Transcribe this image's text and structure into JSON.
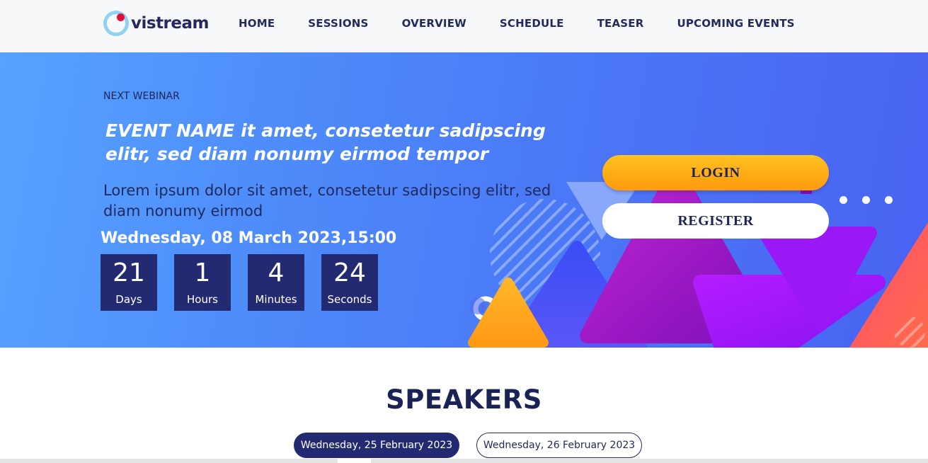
{
  "brand": {
    "name": "vistream",
    "ring_color": "#8fd3f2",
    "dot_color": "#e0103a"
  },
  "nav": {
    "items": [
      "HOME",
      "SESSIONS",
      "OVERVIEW",
      "SCHEDULE",
      "TEASER",
      "UPCOMING EVENTS"
    ]
  },
  "hero": {
    "eyebrow": "NEXT WEBINAR",
    "title": "EVENT NAME it amet, consetetur sadipscing elitr, sed diam nonumy eirmod tempor",
    "subtitle": "Lorem ipsum dolor sit amet, consetetur sadipscing elitr, sed diam nonumy eirmod",
    "date": "Wednesday, 08 March 2023,15:00",
    "countdown": [
      {
        "value": "21",
        "label": "Days"
      },
      {
        "value": "1",
        "label": "Hours"
      },
      {
        "value": "4",
        "label": "Minutes"
      },
      {
        "value": "24",
        "label": "Seconds"
      }
    ],
    "login_label": "LOGIN",
    "register_label": "REGISTER"
  },
  "speakers": {
    "title": "SPEAKERS",
    "date_tabs": [
      "Wednesday, 25 February 2023",
      "Wednesday, 26 February 2023"
    ],
    "active_tab": "Wednesday, 25 February 2023"
  },
  "colors": {
    "accent_dark": "#242a72",
    "login_button": "#ffa913",
    "text_dark": "#1b2356"
  }
}
